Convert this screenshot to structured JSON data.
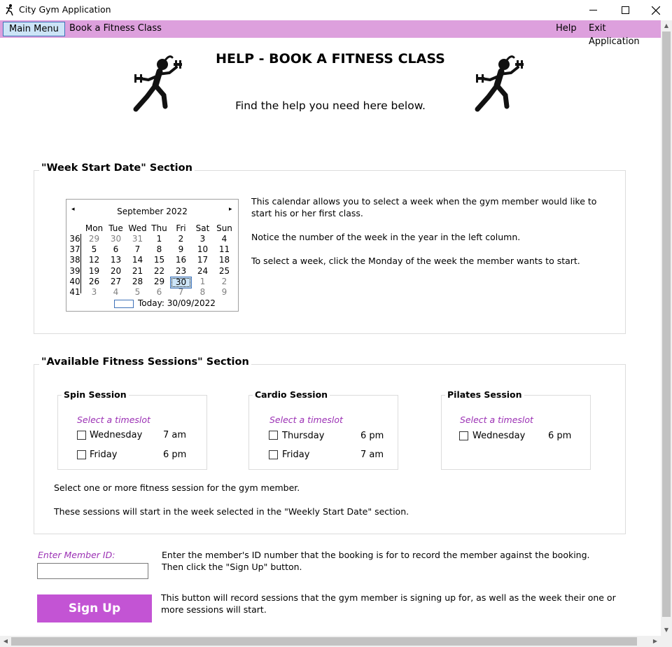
{
  "window": {
    "title": "City Gym Application",
    "controls": {
      "minimize": "minimize",
      "maximize": "maximize",
      "close": "✕"
    }
  },
  "menu": {
    "items_left": [
      "Main Menu",
      "Book a Fitness Class"
    ],
    "items_right": [
      "Help",
      "Exit Application"
    ],
    "active": "Main Menu"
  },
  "header": {
    "title": "HELP - BOOK A FITNESS CLASS",
    "subtitle": "Find the help you need here below.",
    "logo_icon": "runner-with-dumbbells"
  },
  "week_section": {
    "legend": "\"Week Start Date\" Section",
    "help": [
      "This calendar allows you to select a week when the gym member would like to start his or her first class.",
      "Notice the number of the week in the year in the left column.",
      "To select a week, click the Monday of the week the member wants to start."
    ],
    "calendar": {
      "month": "September 2022",
      "prev": "◂",
      "next": "▸",
      "day_headers": [
        "Mon",
        "Tue",
        "Wed",
        "Thu",
        "Fri",
        "Sat",
        "Sun"
      ],
      "weeks": [
        {
          "no": "36",
          "days": [
            "29",
            "30",
            "31",
            "1",
            "2",
            "3",
            "4"
          ],
          "other": [
            true,
            true,
            true,
            false,
            false,
            false,
            false
          ]
        },
        {
          "no": "37",
          "days": [
            "5",
            "6",
            "7",
            "8",
            "9",
            "10",
            "11"
          ],
          "other": [
            false,
            false,
            false,
            false,
            false,
            false,
            false
          ]
        },
        {
          "no": "38",
          "days": [
            "12",
            "13",
            "14",
            "15",
            "16",
            "17",
            "18"
          ],
          "other": [
            false,
            false,
            false,
            false,
            false,
            false,
            false
          ]
        },
        {
          "no": "39",
          "days": [
            "19",
            "20",
            "21",
            "22",
            "23",
            "24",
            "25"
          ],
          "other": [
            false,
            false,
            false,
            false,
            false,
            false,
            false
          ]
        },
        {
          "no": "40",
          "days": [
            "26",
            "27",
            "28",
            "29",
            "30",
            "1",
            "2"
          ],
          "other": [
            false,
            false,
            false,
            false,
            false,
            true,
            true
          ]
        },
        {
          "no": "41",
          "days": [
            "3",
            "4",
            "5",
            "6",
            "7",
            "8",
            "9"
          ],
          "other": [
            true,
            true,
            true,
            true,
            true,
            true,
            true
          ]
        }
      ],
      "selected_day": "30",
      "today_label": "Today: 30/09/2022"
    }
  },
  "sessions_section": {
    "legend": "\"Available Fitness Sessions\" Section",
    "panels": [
      {
        "title": "Spin Session",
        "prompt": "Select a timeslot",
        "slots": [
          {
            "day": "Wednesday",
            "time": "7 am",
            "checked": false
          },
          {
            "day": "Friday",
            "time": "6 pm",
            "checked": false
          }
        ]
      },
      {
        "title": "Cardio Session",
        "prompt": "Select a timeslot",
        "slots": [
          {
            "day": "Thursday",
            "time": "6 pm",
            "checked": false
          },
          {
            "day": "Friday",
            "time": "7 am",
            "checked": false
          }
        ]
      },
      {
        "title": "Pilates Session",
        "prompt": "Select a timeslot",
        "slots": [
          {
            "day": "Wednesday",
            "time": "6 pm",
            "checked": false
          }
        ]
      }
    ],
    "help": [
      "Select one or more fitness session for the gym member.",
      "These sessions will start in the week selected in the \"Weekly Start Date\" section."
    ]
  },
  "member": {
    "label": "Enter Member ID:",
    "value": "",
    "help_line1": "Enter the member's ID number that the booking is for to record the member against the booking.",
    "help_line2": "Then click the \"Sign Up\" button."
  },
  "signup": {
    "label": "Sign Up",
    "help": "This button will record sessions that the gym member is signing up for, as well as the week their one or more sessions will start."
  },
  "colors": {
    "menu_bg": "#dda0dd",
    "accent": "#c354d4",
    "prompt": "#9b30b4"
  }
}
